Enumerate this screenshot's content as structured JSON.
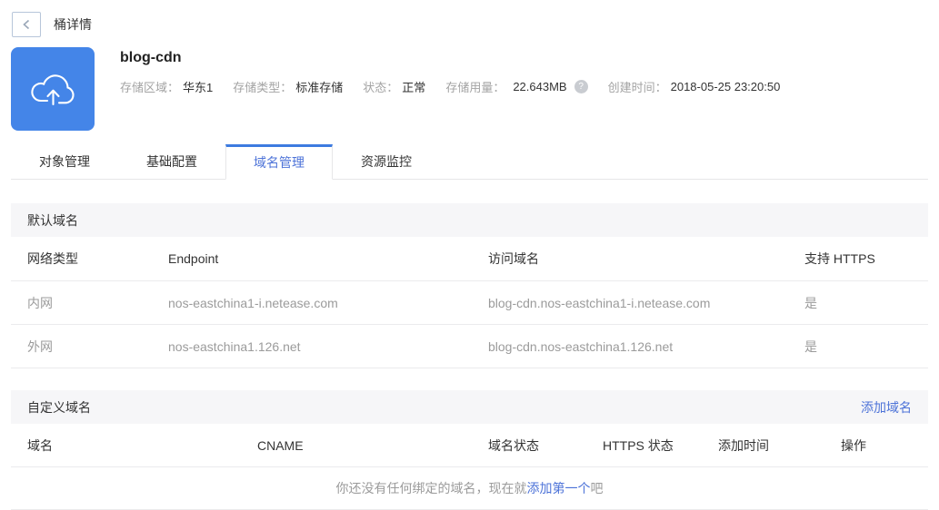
{
  "page": {
    "title": "桶详情"
  },
  "bucket": {
    "name": "blog-cdn",
    "info": [
      {
        "label": "存储区域：",
        "value": "华东1"
      },
      {
        "label": "存储类型：",
        "value": "标准存储"
      },
      {
        "label": "状态：",
        "value": "正常"
      },
      {
        "label": "存储用量：",
        "value": "22.643MB"
      },
      {
        "label": "创建时间：",
        "value": "2018-05-25 23:20:50"
      }
    ],
    "help_icon_glyph": "?"
  },
  "tabs": [
    {
      "label": "对象管理",
      "active": false
    },
    {
      "label": "基础配置",
      "active": false
    },
    {
      "label": "域名管理",
      "active": true
    },
    {
      "label": "资源监控",
      "active": false
    }
  ],
  "default_domains": {
    "title": "默认域名",
    "columns": [
      "网络类型",
      "Endpoint",
      "访问域名",
      "支持 HTTPS"
    ],
    "rows": [
      [
        "内网",
        "nos-eastchina1-i.netease.com",
        "blog-cdn.nos-eastchina1-i.netease.com",
        "是"
      ],
      [
        "外网",
        "nos-eastchina1.126.net",
        "blog-cdn.nos-eastchina1.126.net",
        "是"
      ]
    ]
  },
  "custom_domains": {
    "title": "自定义域名",
    "add_link": "添加域名",
    "columns": [
      "域名",
      "CNAME",
      "域名状态",
      "HTTPS 状态",
      "添加时间",
      "操作"
    ],
    "empty": {
      "prefix": "你还没有任何绑定的域名，现在就",
      "link": "添加第一个",
      "suffix": "吧"
    }
  },
  "colors": {
    "accent_blue": "#4d73d8",
    "tab_active_border": "#3d7be0",
    "bucket_icon_bg": "#4485e8",
    "section_band_bg": "#f6f6f8",
    "muted_text": "#9b9b9b"
  }
}
